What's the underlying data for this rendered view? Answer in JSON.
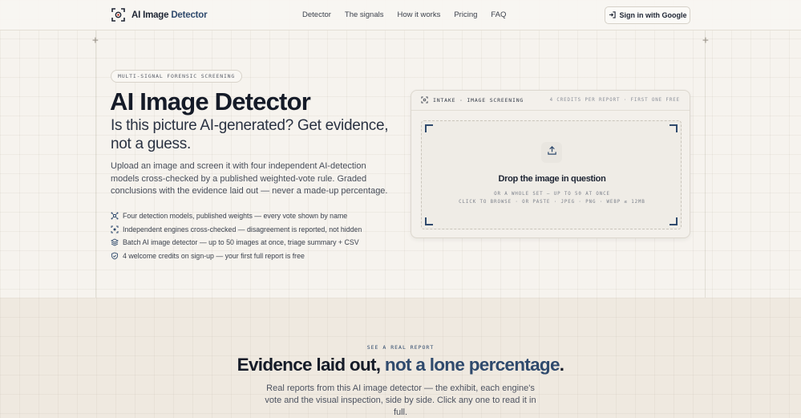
{
  "nav": {
    "brand_prefix": "AI Image ",
    "brand_accent": "Detector",
    "links": [
      "Detector",
      "The signals",
      "How it works",
      "Pricing",
      "FAQ"
    ],
    "signin_label": "Sign in with Google"
  },
  "hero": {
    "eyebrow": "MULTI-SIGNAL FORENSIC SCREENING",
    "title": "AI Image Detector",
    "subtitle": "Is this picture AI-generated? Get evidence, not a guess.",
    "lead": "Upload an image and screen it with four independent AI-detection models cross-checked by a published weighted-vote rule. Graded conclusions with the evidence laid out — never a made-up percentage.",
    "features": [
      {
        "icon": "network-icon",
        "text": "Four detection models, published weights — every vote shown by name"
      },
      {
        "icon": "scan-icon",
        "text": "Independent engines cross-checked — disagreement is reported, not hidden"
      },
      {
        "icon": "layers-icon",
        "text": "Batch AI image detector — up to 50 images at once, triage summary + CSV"
      },
      {
        "icon": "shield-check-icon",
        "text": "4 welcome credits on sign-up — your first full report is free"
      }
    ]
  },
  "intake": {
    "header_label": "INTAKE · IMAGE SCREENING",
    "header_meta": "4 CREDITS PER REPORT · FIRST ONE FREE",
    "drop_title": "Drop the image in question",
    "drop_line1": "OR A WHOLE SET — UP TO 50 AT ONCE",
    "drop_line2": "CLICK TO BROWSE · OR PASTE · JPEG · PNG · WEBP ≤ 12MB"
  },
  "report_section": {
    "eyebrow": "SEE A REAL REPORT",
    "title_plain": "Evidence laid out, ",
    "title_accent": "not a lone percentage",
    "title_end": ".",
    "body": "Real reports from this AI image detector — the exhibit, each engine's vote and the visual inspection, side by side. Click any one to read it in full."
  },
  "colors": {
    "accent": "#2f4a6d",
    "background": "#f6f3ee",
    "section_background": "#efe9e0",
    "text": "#151b28"
  }
}
